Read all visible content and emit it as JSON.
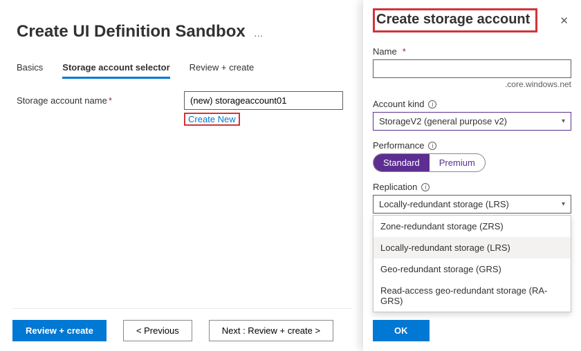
{
  "page": {
    "title": "Create UI Definition Sandbox",
    "more": "…"
  },
  "tabs": {
    "basics": "Basics",
    "selector": "Storage account selector",
    "review": "Review + create"
  },
  "form": {
    "storage_name_label": "Storage account name",
    "storage_name_value": "(new) storageaccount01",
    "create_new": "Create New"
  },
  "footer": {
    "review": "Review + create",
    "prev": "< Previous",
    "next": "Next : Review + create >"
  },
  "panel": {
    "title": "Create storage account",
    "name_label": "Name",
    "name_value": "",
    "name_suffix": ".core.windows.net",
    "kind_label": "Account kind",
    "kind_value": "StorageV2 (general purpose v2)",
    "perf_label": "Performance",
    "perf_standard": "Standard",
    "perf_premium": "Premium",
    "repl_label": "Replication",
    "repl_value": "Locally-redundant storage (LRS)",
    "repl_options": {
      "zrs": "Zone-redundant storage (ZRS)",
      "lrs": "Locally-redundant storage (LRS)",
      "grs": "Geo-redundant storage (GRS)",
      "ragrs": "Read-access geo-redundant storage (RA-GRS)"
    },
    "ok": "OK"
  }
}
